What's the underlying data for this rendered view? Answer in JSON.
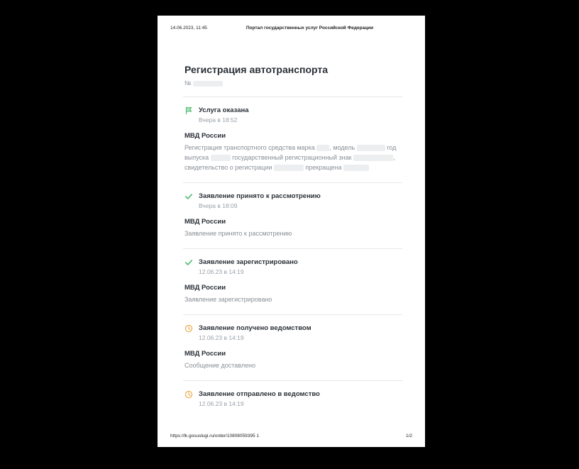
{
  "header": {
    "datetime": "14.06.2023, 11:45",
    "site_title": "Портал государственных услуг Российской Федерации"
  },
  "footer": {
    "url": "https://lk.gosuslugi.ru/order/10808059395 1",
    "page": "1/2"
  },
  "page": {
    "title": "Регистрация автотранспорта",
    "number_label": "№"
  },
  "steps": [
    {
      "icon": "flag",
      "title": "Услуга оказана",
      "time": "Вчера в 18:52",
      "org": "МВД России",
      "desc_parts": {
        "t1": "Регистрация транспортного средства марка ",
        "t2": ", модель ",
        "t3": " год выпуска ",
        "t4": " государственный регистрационный знак ",
        "t5": ", свидетельство о регистрации ",
        "t6": " прекращена "
      }
    },
    {
      "icon": "check",
      "title": "Заявление принято к рассмотрению",
      "time": "Вчера в 18:09",
      "org": "МВД России",
      "desc": "Заявление принято к рассмотрению"
    },
    {
      "icon": "check",
      "title": "Заявление зарегистрировано",
      "time": "12.06.23 в 14:19",
      "org": "МВД России",
      "desc": "Заявление зарегистрировано"
    },
    {
      "icon": "clock",
      "title": "Заявление получено ведомством",
      "time": "12.06.23 в 14:19",
      "org": "МВД России",
      "desc": "Сообщение доставлено"
    },
    {
      "icon": "clock",
      "title": "Заявление отправлено в ведомство",
      "time": "12.06.23 в 14:19"
    }
  ]
}
